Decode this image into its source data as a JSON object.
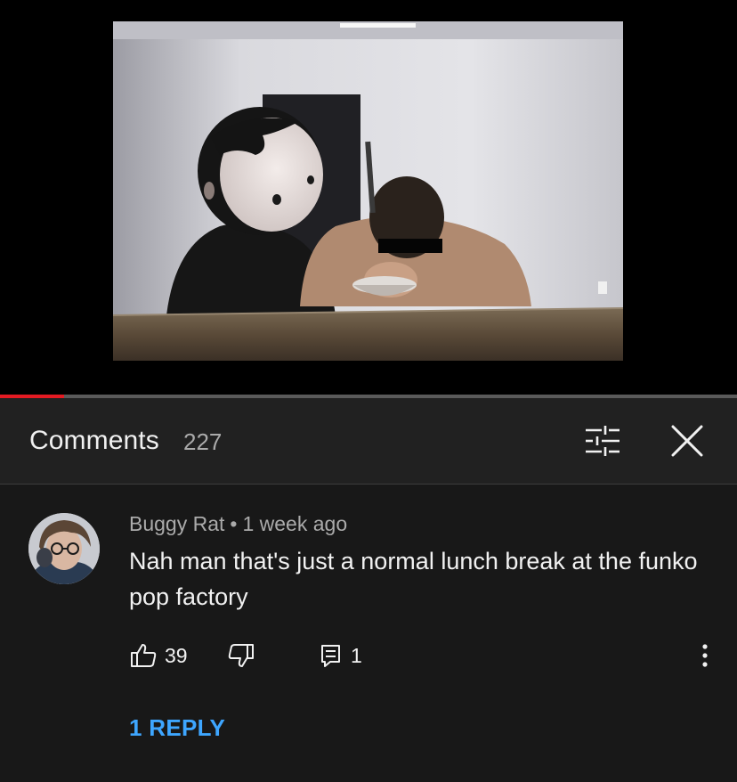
{
  "player": {
    "progress_fraction": 0.087
  },
  "comments_panel": {
    "title": "Comments",
    "count": "227",
    "filter_icon": "sort-sliders-icon",
    "close_icon": "close-icon"
  },
  "comment": {
    "author": "Buggy Rat",
    "separator": "•",
    "time": "1 week ago",
    "text": "Nah man that's just a normal lunch break at the funko pop factory",
    "likes": "39",
    "replies_count": "1",
    "replies_link": "1 REPLY",
    "icons": {
      "like": "thumbs-up-icon",
      "dislike": "thumbs-down-icon",
      "reply": "reply-comment-icon",
      "more": "more-vertical-icon"
    }
  },
  "colors": {
    "background": "#212121",
    "comment_background": "#181818",
    "progress": "#e31b23",
    "link": "#3ea6ff",
    "secondary_text": "#aaaaaa"
  }
}
